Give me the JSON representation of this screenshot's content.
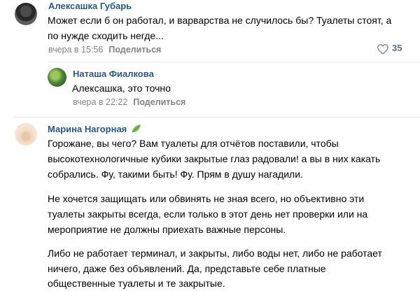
{
  "comments": [
    {
      "author": "Алексашка Губарь",
      "lines": [
        "Может если б он работал, и варварства не случилось бы? Туалеты стоят, а",
        "по нужде сходить негде..."
      ],
      "date": "вчера в 15:56",
      "share": "Поделиться",
      "likes": "35",
      "avatar_icon": "user-photo"
    },
    {
      "author": "Наташа Фиалкова",
      "lines": [
        "Алексашка, это точно"
      ],
      "date": "вчера в 22:22",
      "share": "Поделиться",
      "avatar_icon": "user-photo"
    },
    {
      "author": "Марина Нагорная",
      "badge_icon": "leaf-icon",
      "paragraphs": [
        [
          "Горожане, вы чего? Вам туалеты для отчётов поставили, чтобы",
          "высокотехнологичные кубики закрытые глаз радовали! а вы в них какать",
          "собрались. Фу, такими быть! Фу. Прям в душу нагадили."
        ],
        [
          "Не хочется защищать или обвинять не зная всего, но объективно эти",
          "туалеты закрыты всегда, если только в этот день нет проверки или на",
          "мероприятие не должны приехать важные персоны."
        ],
        [
          "Либо не работает терминал, и закрыты, либо воды нет, либо не работает",
          "ничего, даже без объявлений. Да, представьте себе платные",
          "общественные туалеты и те закрытые."
        ]
      ],
      "avatar_icon": "user-photo"
    }
  ],
  "colors": {
    "author": "#2a5885",
    "meta": "#828282",
    "divider": "#e7e8ec"
  }
}
